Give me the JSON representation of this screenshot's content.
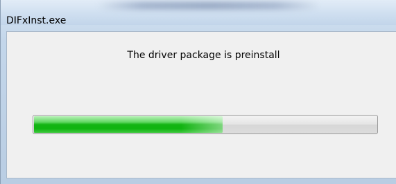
{
  "window": {
    "title": "DIFxInst.exe"
  },
  "dialog": {
    "message": "The driver package is preinstall"
  },
  "progress": {
    "value_fraction": 0.55,
    "fill_color": "#14b414",
    "track_color": "#dcdcdc"
  }
}
